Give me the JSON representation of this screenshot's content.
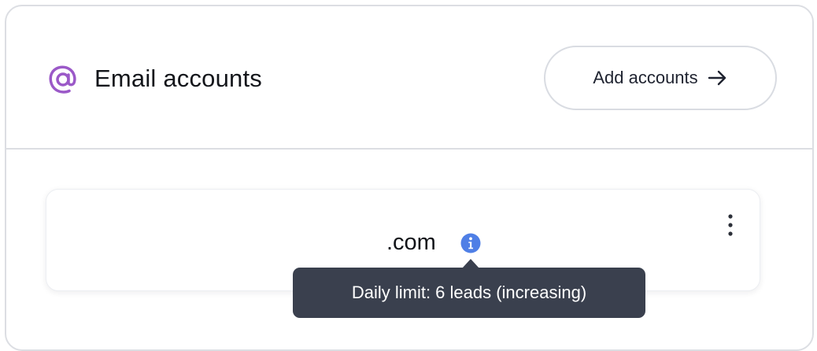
{
  "header": {
    "title": "Email accounts",
    "icon": "at-sign-icon",
    "icon_color": "#9b59c8",
    "add_button_label": "Add accounts",
    "add_button_icon": "arrow-right-icon"
  },
  "accounts": [
    {
      "domain": ".com",
      "info_icon": "info-icon",
      "info_icon_color": "#4f7fe6",
      "menu_icon": "more-vertical-icon"
    }
  ],
  "tooltip": {
    "text": "Daily limit: 6 leads (increasing)"
  }
}
